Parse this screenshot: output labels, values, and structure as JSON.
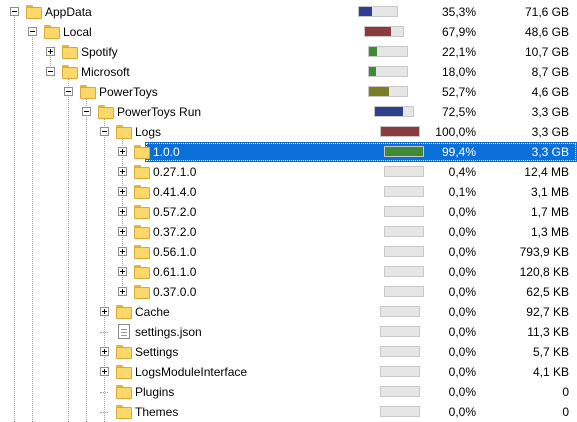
{
  "rows": [
    {
      "name": "AppData",
      "pct": "35,3%",
      "size": "71,6 GB",
      "fill": 0.353,
      "color": "#2e3f8e",
      "depth": 0,
      "expander": "minus",
      "icon": "folder"
    },
    {
      "name": "Local",
      "pct": "67,9%",
      "size": "48,6 GB",
      "fill": 0.679,
      "color": "#8b3b3b",
      "depth": 1,
      "expander": "minus",
      "icon": "folder"
    },
    {
      "name": "Spotify",
      "pct": "22,1%",
      "size": "10,7 GB",
      "fill": 0.221,
      "color": "#3f8a35",
      "depth": 2,
      "expander": "plus",
      "icon": "folder"
    },
    {
      "name": "Microsoft",
      "pct": "18,0%",
      "size": "8,7 GB",
      "fill": 0.18,
      "color": "#3f8a35",
      "depth": 2,
      "expander": "minus",
      "icon": "folder"
    },
    {
      "name": "PowerToys",
      "pct": "52,7%",
      "size": "4,6 GB",
      "fill": 0.527,
      "color": "#7d7d28",
      "depth": 3,
      "expander": "minus",
      "icon": "folder"
    },
    {
      "name": "PowerToys Run",
      "pct": "72,5%",
      "size": "3,3 GB",
      "fill": 0.725,
      "color": "#2e3f8e",
      "depth": 4,
      "expander": "minus",
      "icon": "folder"
    },
    {
      "name": "Logs",
      "pct": "100,0%",
      "size": "3,3 GB",
      "fill": 1.0,
      "color": "#8b3b3b",
      "depth": 5,
      "expander": "minus",
      "icon": "folder"
    },
    {
      "name": "1.0.0",
      "pct": "99,4%",
      "size": "3,3 GB",
      "fill": 0.994,
      "color": "#3f8a35",
      "depth": 6,
      "expander": "plus",
      "icon": "folder",
      "selected": true
    },
    {
      "name": "0.27.1.0",
      "pct": "0,4%",
      "size": "12,4 MB",
      "fill": 0.004,
      "color": "#3f8a35",
      "depth": 6,
      "expander": "plus",
      "icon": "folder"
    },
    {
      "name": "0.41.4.0",
      "pct": "0,1%",
      "size": "3,1 MB",
      "fill": 0.001,
      "color": "#3f8a35",
      "depth": 6,
      "expander": "plus",
      "icon": "folder"
    },
    {
      "name": "0.57.2.0",
      "pct": "0,0%",
      "size": "1,7 MB",
      "fill": 0,
      "color": "#3f8a35",
      "depth": 6,
      "expander": "plus",
      "icon": "folder"
    },
    {
      "name": "0.37.2.0",
      "pct": "0,0%",
      "size": "1,3 MB",
      "fill": 0,
      "color": "#3f8a35",
      "depth": 6,
      "expander": "plus",
      "icon": "folder"
    },
    {
      "name": "0.56.1.0",
      "pct": "0,0%",
      "size": "793,9 KB",
      "fill": 0,
      "color": "#3f8a35",
      "depth": 6,
      "expander": "plus",
      "icon": "folder"
    },
    {
      "name": "0.61.1.0",
      "pct": "0,0%",
      "size": "120,8 KB",
      "fill": 0,
      "color": "#3f8a35",
      "depth": 6,
      "expander": "plus",
      "icon": "folder"
    },
    {
      "name": "0.37.0.0",
      "pct": "0,0%",
      "size": "62,5 KB",
      "fill": 0,
      "color": "#3f8a35",
      "depth": 6,
      "expander": "plus",
      "icon": "folder"
    },
    {
      "name": "Cache",
      "pct": "0,0%",
      "size": "92,7 KB",
      "fill": 0,
      "color": "#8b3b3b",
      "depth": 5,
      "expander": "plus",
      "icon": "folder"
    },
    {
      "name": "settings.json",
      "pct": "0,0%",
      "size": "11,3 KB",
      "fill": 0,
      "color": "#8b3b3b",
      "depth": 5,
      "expander": "none",
      "icon": "file"
    },
    {
      "name": "Settings",
      "pct": "0,0%",
      "size": "5,7 KB",
      "fill": 0,
      "color": "#8b3b3b",
      "depth": 5,
      "expander": "plus",
      "icon": "folder"
    },
    {
      "name": "LogsModuleInterface",
      "pct": "0,0%",
      "size": "4,1 KB",
      "fill": 0,
      "color": "#8b3b3b",
      "depth": 5,
      "expander": "plus",
      "icon": "folder"
    },
    {
      "name": "Plugins",
      "pct": "0,0%",
      "size": "0",
      "fill": 0,
      "color": "#8b3b3b",
      "depth": 5,
      "expander": "none",
      "icon": "folder"
    },
    {
      "name": "Themes",
      "pct": "0,0%",
      "size": "0",
      "fill": 0,
      "color": "#8b3b3b",
      "depth": 5,
      "expander": "none",
      "icon": "folder"
    }
  ]
}
